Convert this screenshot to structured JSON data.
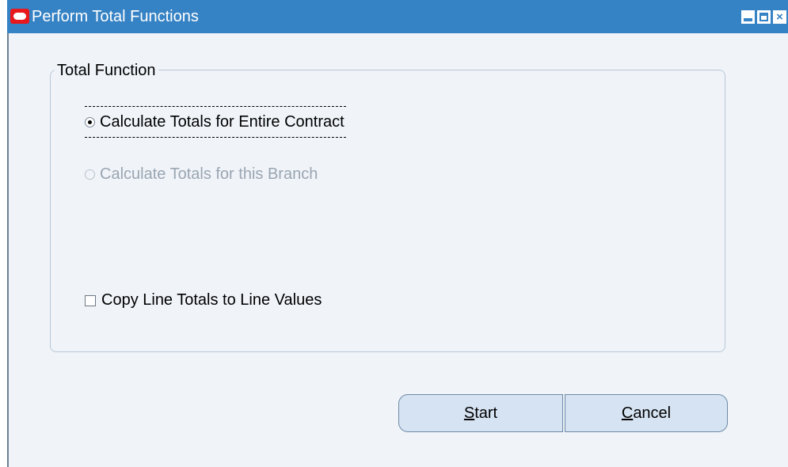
{
  "window": {
    "title": "Perform Total Functions",
    "controls": [
      "minimize",
      "maximize",
      "close"
    ]
  },
  "group": {
    "label": "Total Function",
    "options": [
      {
        "label": "Calculate Totals for Entire Contract",
        "selected": true,
        "enabled": true
      },
      {
        "label": "Calculate Totals for this Branch",
        "selected": false,
        "enabled": false
      }
    ],
    "checkbox": {
      "label": "Copy Line Totals to Line Values",
      "checked": false
    }
  },
  "buttons": {
    "start": {
      "mnemonic": "S",
      "rest": "tart"
    },
    "cancel": {
      "mnemonic": "C",
      "rest": "ancel"
    }
  },
  "colors": {
    "titlebar": "#3582c4",
    "client_bg": "#f0f4f9",
    "button_bg": "#d6e3f2",
    "disabled_text": "#9aa5b1",
    "logo": "#e8191d"
  }
}
